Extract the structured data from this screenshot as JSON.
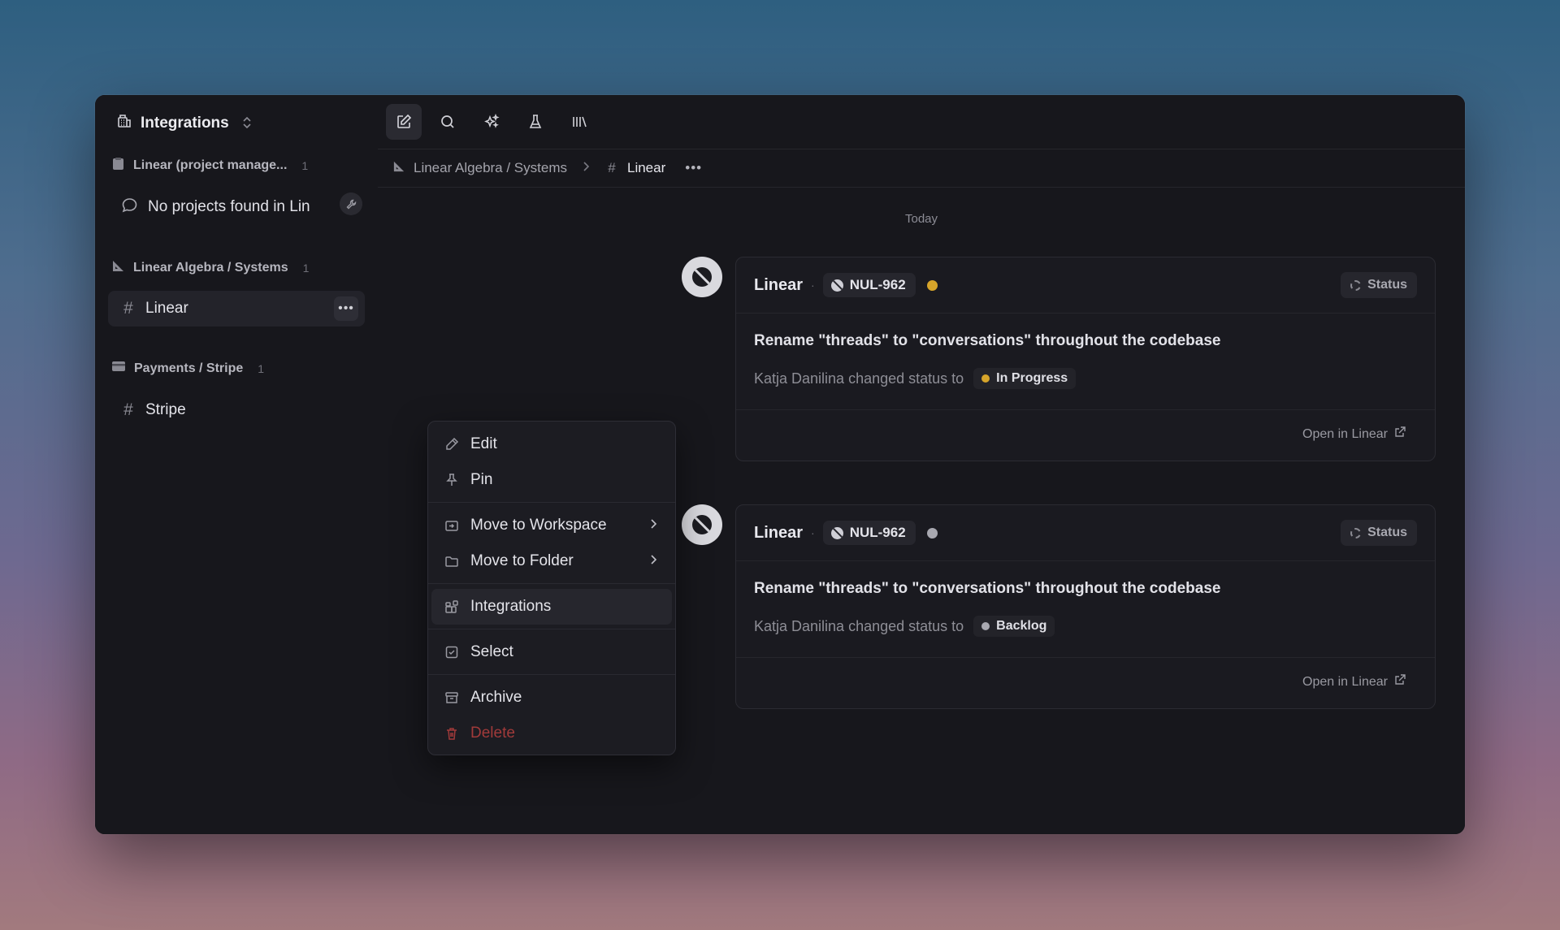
{
  "workspace": {
    "name": "Integrations"
  },
  "sidebar": {
    "groups": [
      {
        "label": "Linear (project manage...",
        "count": "1"
      },
      {
        "label": "Linear Algebra / Systems",
        "count": "1"
      },
      {
        "label": "Payments / Stripe",
        "count": "1"
      }
    ],
    "empty_message": "No projects found in Lin",
    "items": {
      "linear": "Linear",
      "stripe": "Stripe"
    }
  },
  "breadcrumb": {
    "parent": "Linear Algebra / Systems",
    "current": "Linear"
  },
  "feed": {
    "day_label": "Today",
    "cards": [
      {
        "source": "Linear",
        "issue_id": "NUL-962",
        "dot_color": "#d6a42a",
        "status_label": "Status",
        "title": "Rename \"threads\" to \"conversations\" throughout the codebase",
        "actor_text": "Katja Danilina changed status to",
        "new_status": "In Progress",
        "new_status_color": "#d6a42a",
        "link_text": "Open in Linear"
      },
      {
        "source": "Linear",
        "issue_id": "NUL-962",
        "dot_color": "#a8a8b0",
        "status_label": "Status",
        "title": "Rename \"threads\" to \"conversations\" throughout the codebase",
        "actor_text": "Katja Danilina changed status to",
        "new_status": "Backlog",
        "new_status_color": "#a8a8b0",
        "link_text": "Open in Linear"
      }
    ]
  },
  "context_menu": {
    "edit": "Edit",
    "pin": "Pin",
    "move_workspace": "Move to Workspace",
    "move_folder": "Move to Folder",
    "integrations": "Integrations",
    "select": "Select",
    "archive": "Archive",
    "delete": "Delete"
  }
}
